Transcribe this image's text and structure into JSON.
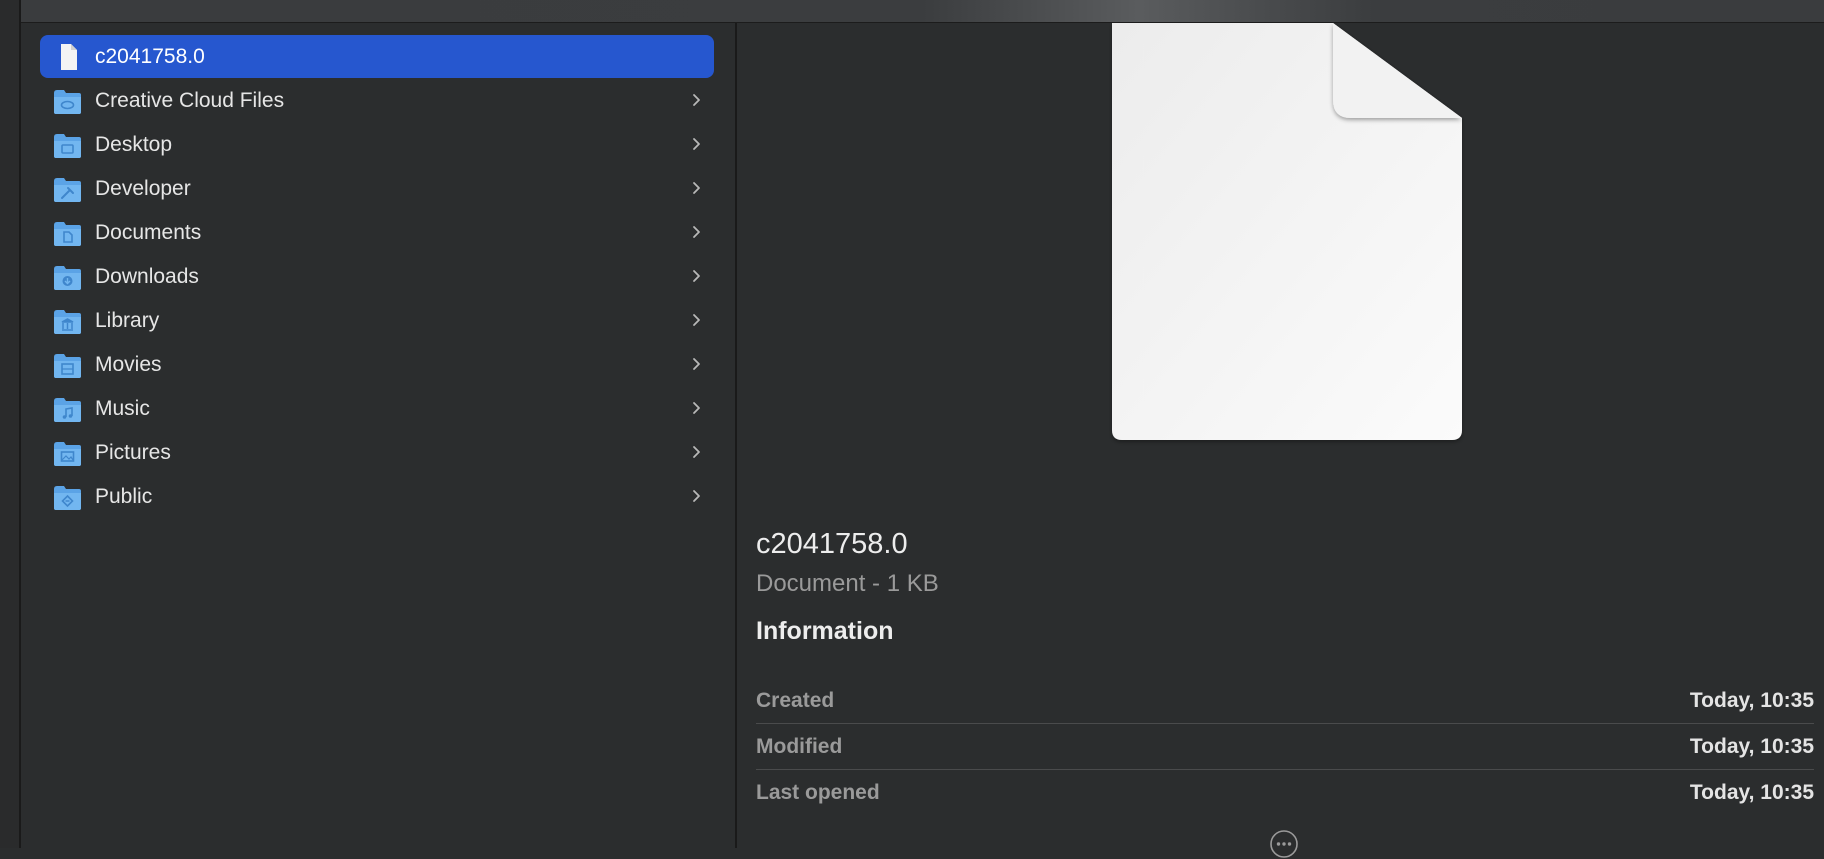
{
  "column": {
    "items": [
      {
        "label": "c2041758.0",
        "icon": "document-icon",
        "selected": true,
        "has_children": false
      },
      {
        "label": "Creative Cloud Files",
        "icon": "creative-cloud-folder-icon",
        "has_children": true
      },
      {
        "label": "Desktop",
        "icon": "desktop-folder-icon",
        "has_children": true
      },
      {
        "label": "Developer",
        "icon": "developer-folder-icon",
        "has_children": true
      },
      {
        "label": "Documents",
        "icon": "documents-folder-icon",
        "has_children": true
      },
      {
        "label": "Downloads",
        "icon": "downloads-folder-icon",
        "has_children": true
      },
      {
        "label": "Library",
        "icon": "library-folder-icon",
        "has_children": true
      },
      {
        "label": "Movies",
        "icon": "movies-folder-icon",
        "has_children": true
      },
      {
        "label": "Music",
        "icon": "music-folder-icon",
        "has_children": true
      },
      {
        "label": "Pictures",
        "icon": "pictures-folder-icon",
        "has_children": true
      },
      {
        "label": "Public",
        "icon": "public-folder-icon",
        "has_children": true
      }
    ]
  },
  "preview": {
    "file_name": "c2041758.0",
    "kind": "Document - 1 KB",
    "info_title": "Information",
    "info": [
      {
        "key": "Created",
        "value": "Today, 10:35"
      },
      {
        "key": "Modified",
        "value": "Today, 10:35"
      },
      {
        "key": "Last opened",
        "value": "Today, 10:35"
      }
    ],
    "more_icon": "more-ellipsis-icon"
  },
  "colors": {
    "selection": "#2657cf",
    "folder": "#5ba3e6",
    "background": "#2b2d2e"
  }
}
